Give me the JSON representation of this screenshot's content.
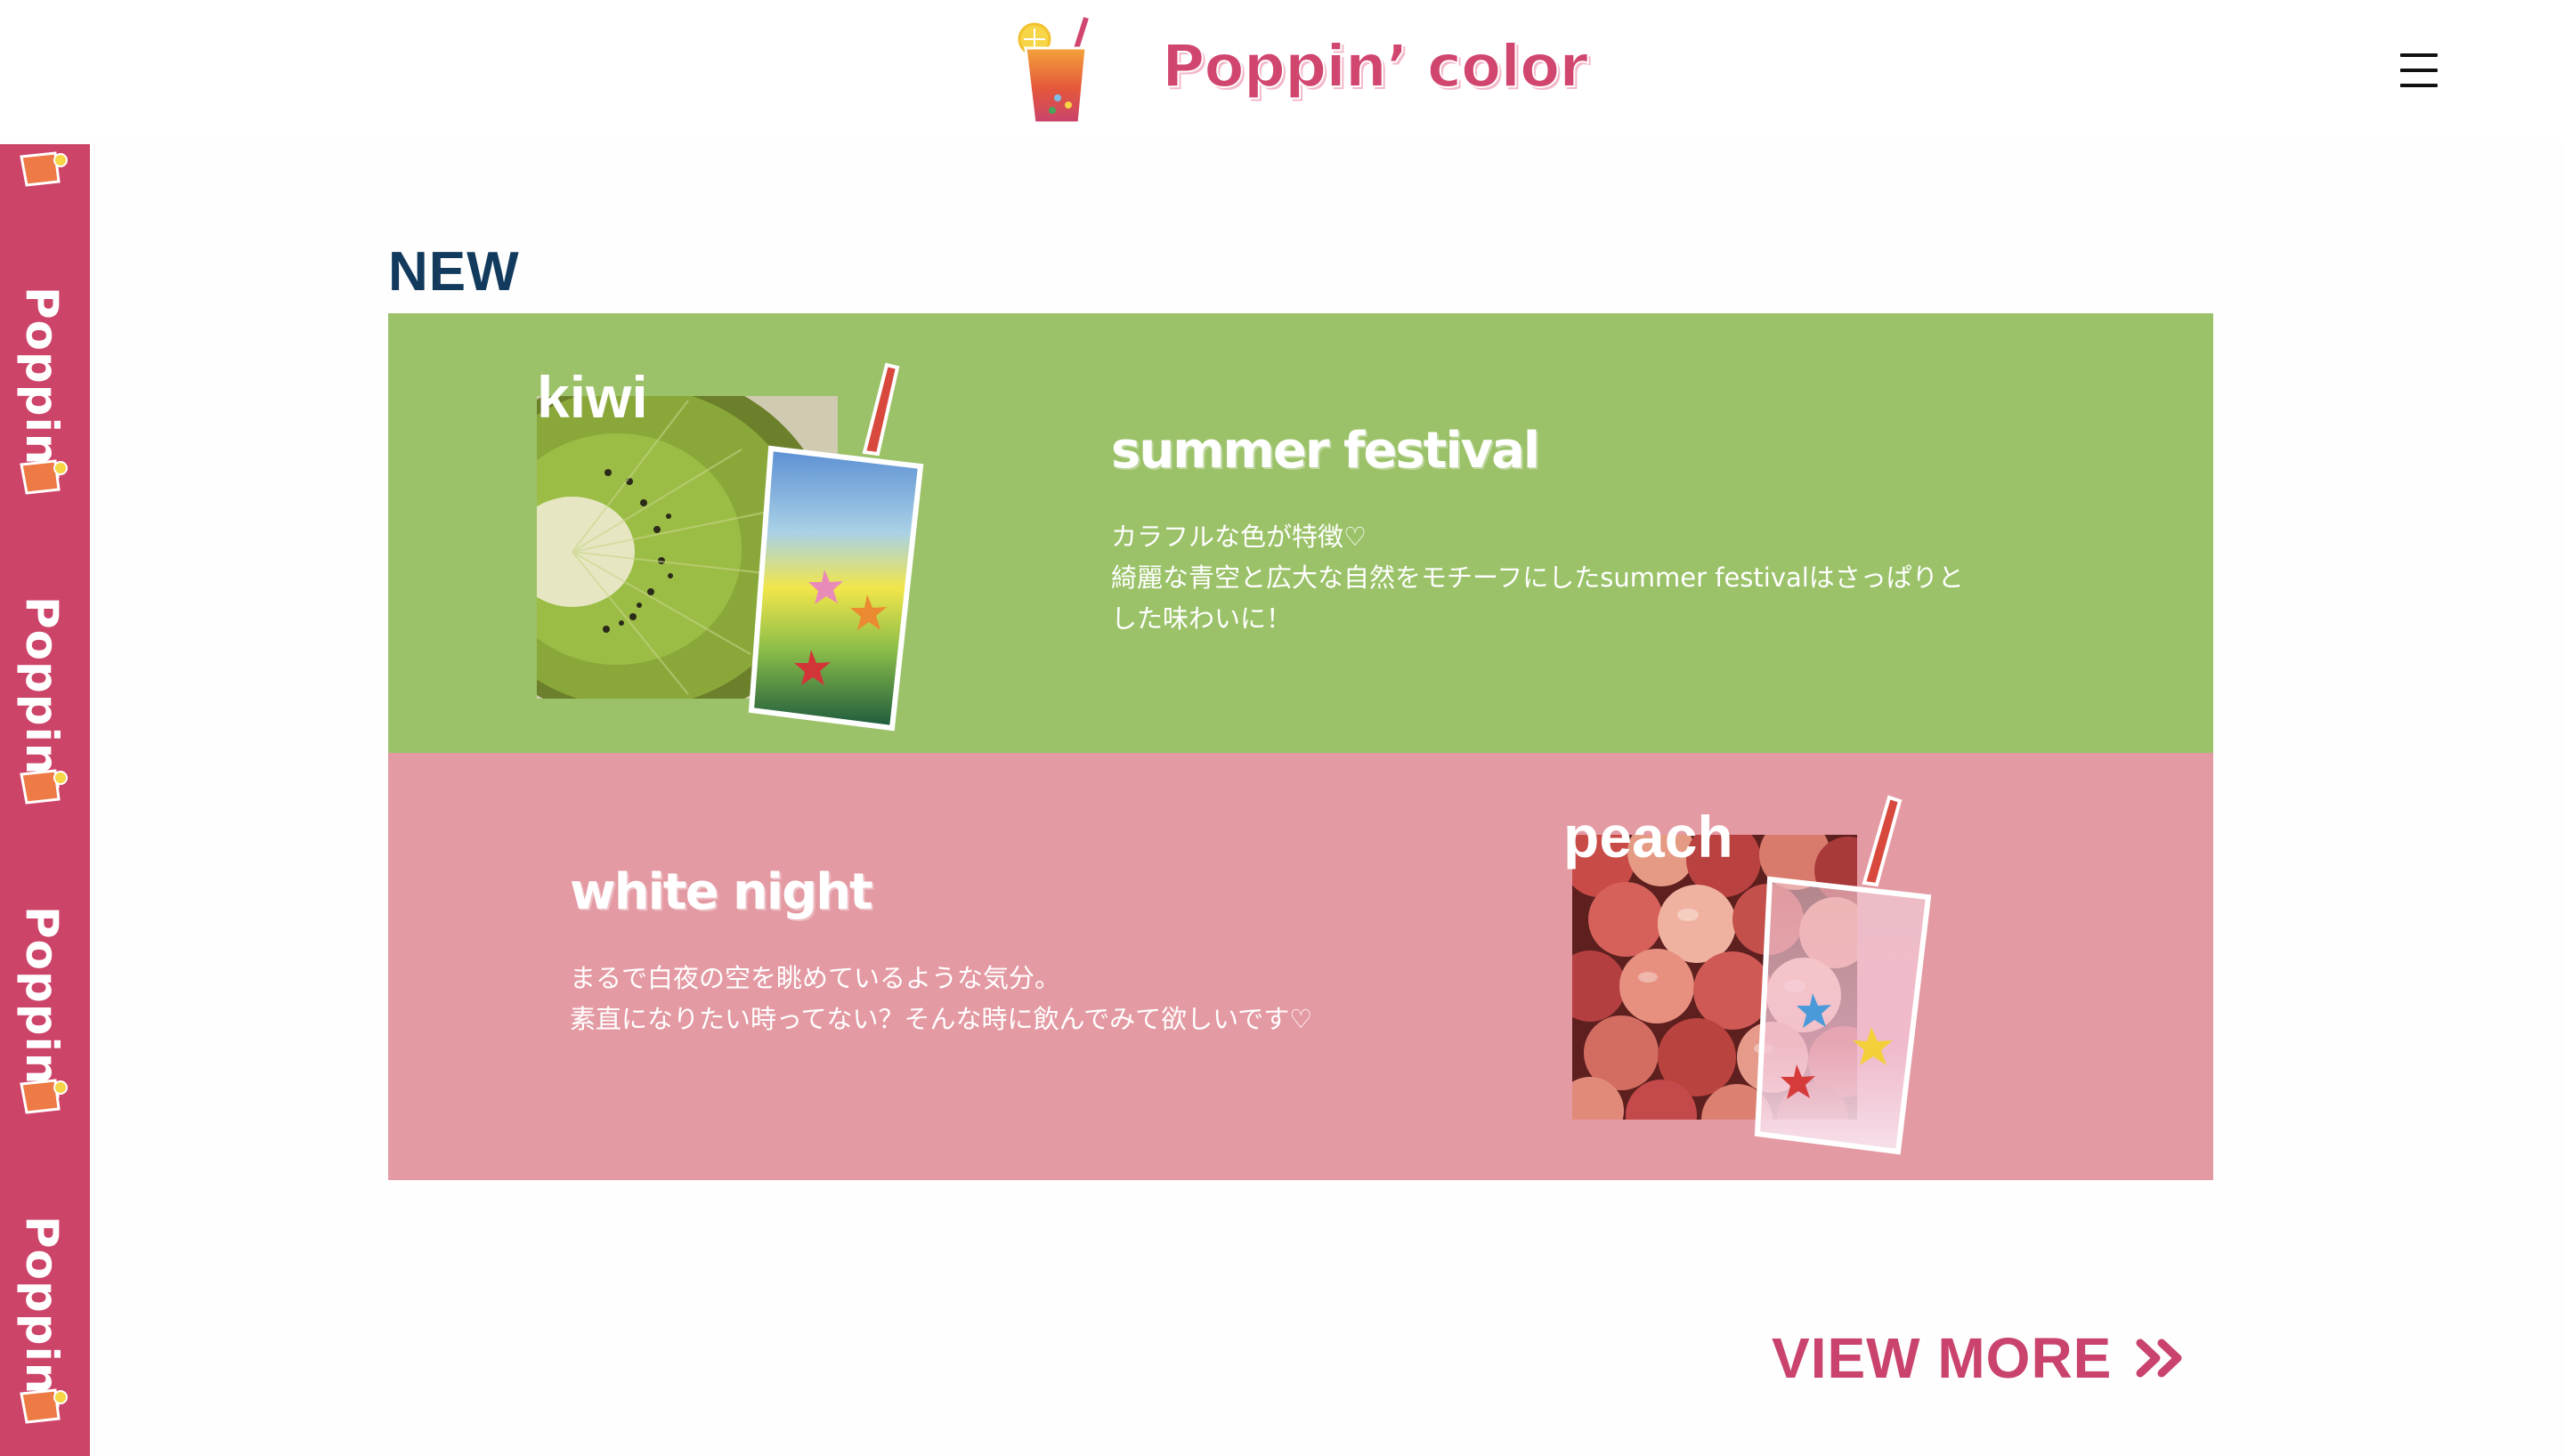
{
  "header": {
    "brand": "Poppin’ color",
    "menu_icon": "hamburger-menu-icon"
  },
  "side_banner": {
    "text": "Poppin’",
    "color": "#cd4469"
  },
  "new_section": {
    "heading": "NEW",
    "items": [
      {
        "fruit": "kiwi",
        "title": "summer festival",
        "description_lines": [
          "カラフルな色が特徴♡",
          "綺麗な青空と広大な自然をモチーフにしたsummer festivalはさっぱりと",
          "した味わいに！"
        ],
        "background": "#9bc269"
      },
      {
        "fruit": "peach",
        "title": "white night",
        "description_lines": [
          "まるで白夜の空を眺めているような気分。",
          "素直になりたい時ってない？そんな時に飲んでみて欲しいです♡"
        ],
        "background": "#e49aa3"
      }
    ]
  },
  "view_more": {
    "label": "VIEW MORE",
    "icon": "double-chevron-right-icon",
    "color": "#c9436d"
  },
  "colors": {
    "heading": "#113a5d",
    "accent": "#cd4469"
  }
}
